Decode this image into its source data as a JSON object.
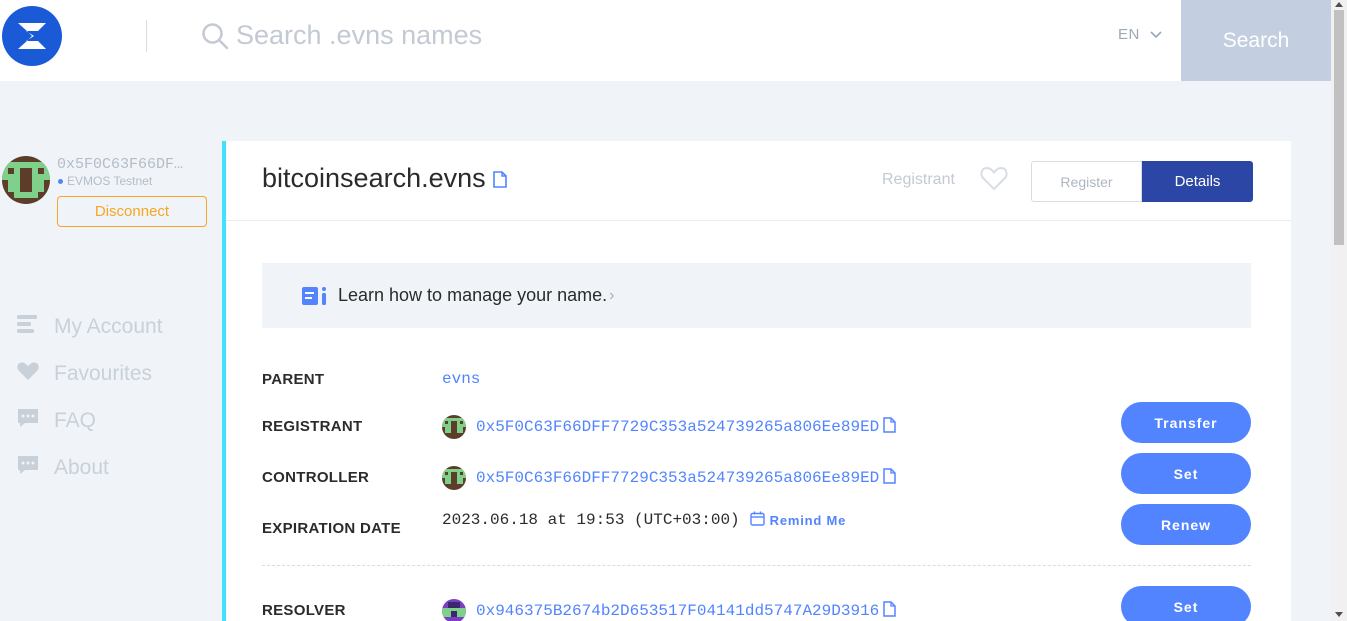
{
  "header": {
    "search_placeholder": "Search .evns names",
    "language": "EN",
    "search_button": "Search"
  },
  "sidebar": {
    "account_address": "0x5F0C63F66DF…",
    "network": "EVMOS Testnet",
    "disconnect_label": "Disconnect",
    "nav": [
      {
        "label": "My Account",
        "icon": "list-icon"
      },
      {
        "label": "Favourites",
        "icon": "heart-icon"
      },
      {
        "label": "FAQ",
        "icon": "chat-icon"
      },
      {
        "label": "About",
        "icon": "chat-icon"
      }
    ]
  },
  "domain": {
    "name": "bitcoinsearch.evns",
    "registrant_label": "Registrant",
    "tabs": {
      "register": "Register",
      "details": "Details"
    }
  },
  "learn_banner": "Learn how to manage your name.",
  "details": {
    "parent": {
      "label": "PARENT",
      "value": "evns"
    },
    "registrant": {
      "label": "REGISTRANT",
      "value": "0x5F0C63F66DFF7729C353a524739265a806Ee89ED",
      "action": "Transfer"
    },
    "controller": {
      "label": "CONTROLLER",
      "value": "0x5F0C63F66DFF7729C353a524739265a806Ee89ED",
      "action": "Set"
    },
    "expiration": {
      "label": "EXPIRATION DATE",
      "value": "2023.06.18 at 19:53 (UTC+03:00)",
      "remind": "Remind Me",
      "action": "Renew"
    },
    "resolver": {
      "label": "RESOLVER",
      "value": "0x946375B2674b2D653517F04141dd5747A29D3916",
      "action": "Set"
    }
  },
  "colors": {
    "brand": "#1a5ad7",
    "accent": "#5284ff",
    "details_tab": "#2c46a6",
    "disconnect": "#f5a623",
    "card_border": "#42e0ff"
  }
}
